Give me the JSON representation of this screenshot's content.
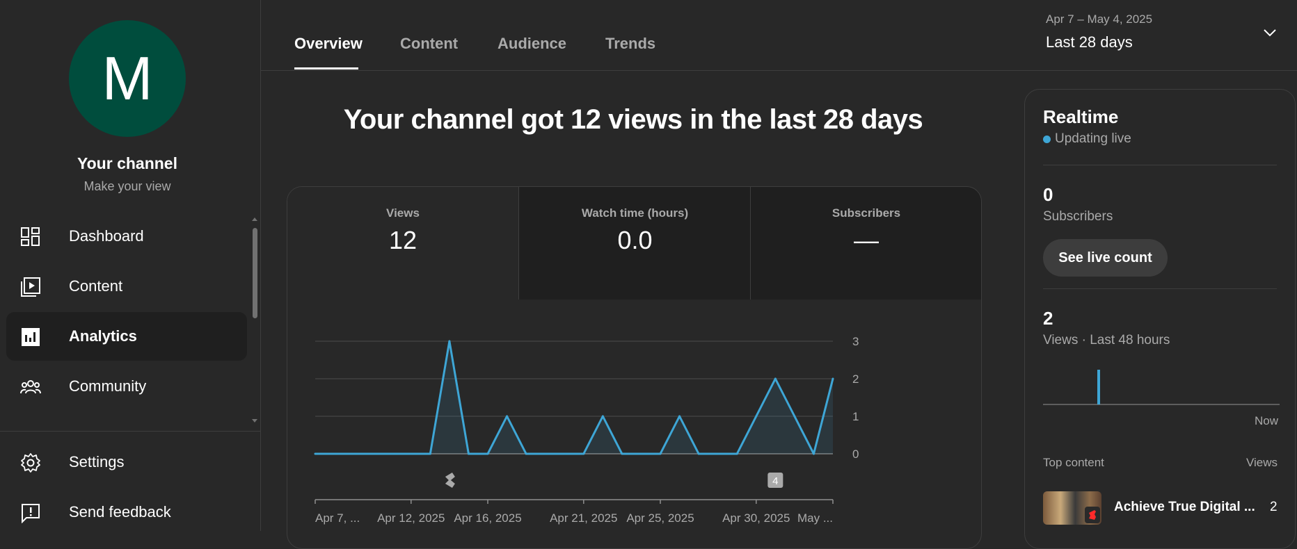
{
  "sidebar": {
    "avatar_letter": "M",
    "avatar_color": "#004d3d",
    "channel_name": "Your channel",
    "channel_sub": "Make your view",
    "items": [
      {
        "label": "Dashboard",
        "icon": "dashboard-icon"
      },
      {
        "label": "Content",
        "icon": "content-icon"
      },
      {
        "label": "Analytics",
        "icon": "analytics-icon",
        "active": true
      },
      {
        "label": "Community",
        "icon": "community-icon"
      }
    ],
    "bottom_items": [
      {
        "label": "Settings",
        "icon": "gear-icon"
      },
      {
        "label": "Send feedback",
        "icon": "feedback-icon"
      }
    ]
  },
  "tabs": [
    {
      "label": "Overview",
      "active": true
    },
    {
      "label": "Content"
    },
    {
      "label": "Audience"
    },
    {
      "label": "Trends"
    }
  ],
  "date_range": {
    "dates": "Apr 7 – May 4, 2025",
    "label": "Last 28 days"
  },
  "headline": "Your channel got 12 views in the last 28 days",
  "metrics": [
    {
      "label": "Views",
      "value": "12"
    },
    {
      "label": "Watch time (hours)",
      "value": "0.0"
    },
    {
      "label": "Subscribers",
      "value": "—"
    }
  ],
  "chart_data": {
    "type": "area",
    "x": [
      "Apr 7",
      "Apr 8",
      "Apr 9",
      "Apr 10",
      "Apr 11",
      "Apr 12",
      "Apr 13",
      "Apr 14",
      "Apr 15",
      "Apr 16",
      "Apr 17",
      "Apr 18",
      "Apr 19",
      "Apr 20",
      "Apr 21",
      "Apr 22",
      "Apr 23",
      "Apr 24",
      "Apr 25",
      "Apr 26",
      "Apr 27",
      "Apr 28",
      "Apr 29",
      "Apr 30",
      "May 1",
      "May 2",
      "May 3",
      "May 4"
    ],
    "values": [
      0,
      0,
      0,
      0,
      0,
      0,
      0,
      3,
      0,
      0,
      1,
      0,
      0,
      0,
      0,
      1,
      0,
      0,
      0,
      1,
      0,
      0,
      0,
      1,
      2,
      1,
      0,
      2
    ],
    "y_ticks": [
      "3",
      "2",
      "1",
      "0"
    ],
    "ylim": [
      0,
      3
    ],
    "x_tick_labels": [
      "Apr 7, ...",
      "Apr 12, 2025",
      "Apr 16, 2025",
      "Apr 21, 2025",
      "Apr 25, 2025",
      "Apr 30, 2025",
      "May ..."
    ],
    "markers": [
      {
        "date": "Apr 14",
        "icon": "shorts-icon"
      },
      {
        "date": "May 1",
        "label": "4"
      }
    ],
    "line_color": "#3ea6d6",
    "grid": true
  },
  "realtime": {
    "title": "Realtime",
    "live_text": "Updating live",
    "subscribers_value": "0",
    "subscribers_label": "Subscribers",
    "live_button": "See live count",
    "views_value": "2",
    "views_label": "Views · Last 48 hours",
    "now_label": "Now",
    "top_content_label": "Top content",
    "top_content_views_label": "Views",
    "top_item": {
      "title": "Achieve True Digital ...",
      "views": "2"
    }
  }
}
